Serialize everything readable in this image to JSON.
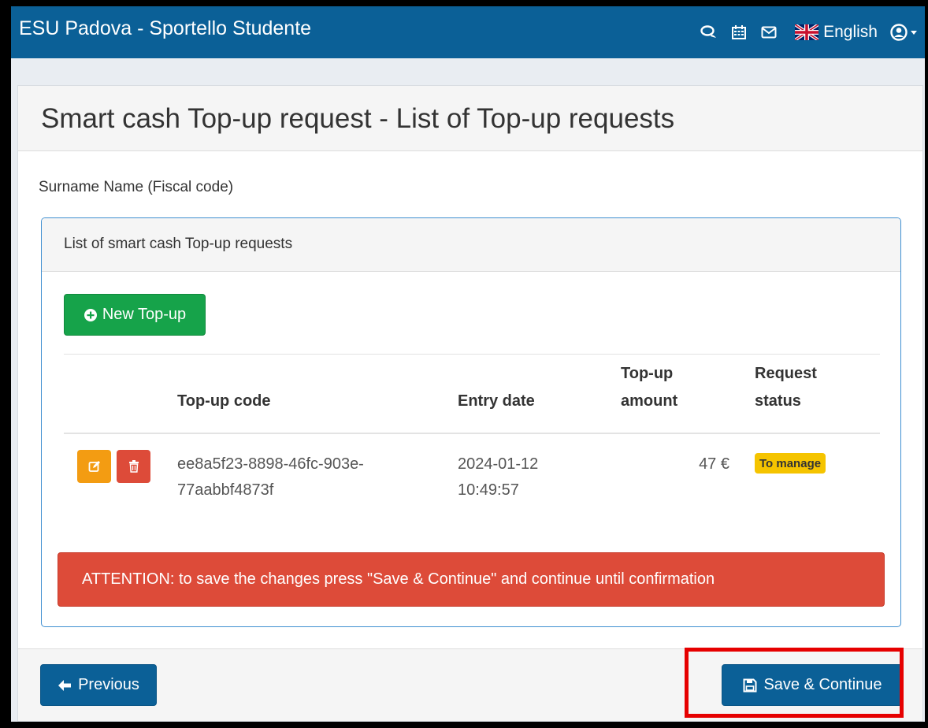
{
  "navbar": {
    "brand": "ESU Padova - Sportello Studente",
    "icons": [
      "chat-icon",
      "calendar-icon",
      "envelope-icon"
    ],
    "language": "English",
    "user_icon": "user-circle-icon"
  },
  "page": {
    "title": "Smart cash Top-up request - List of Top-up requests",
    "student_info": "Surname Name (Fiscal code)"
  },
  "requests_panel": {
    "heading": "List of smart cash Top-up requests",
    "new_button": "New Top-up",
    "columns": [
      "Top-up code",
      "Entry date",
      "Top-up amount",
      "Request status"
    ],
    "rows": [
      {
        "code": "ee8a5f23-8898-46fc-903e-77aabbf4873f",
        "entry_date": "2024-01-12 10:49:57",
        "amount": "47 €",
        "status": "To manage"
      }
    ]
  },
  "alert": "ATTENTION: to save the changes press \"Save & Continue\" and continue until confirmation",
  "footer": {
    "previous": "Previous",
    "save": "Save & Continue"
  },
  "colors": {
    "navbar": "#0b6097",
    "success": "#16a34a",
    "danger": "#dd4b39",
    "warning": "#f39c12",
    "badge": "#f5c400",
    "highlight": "#e60000"
  }
}
